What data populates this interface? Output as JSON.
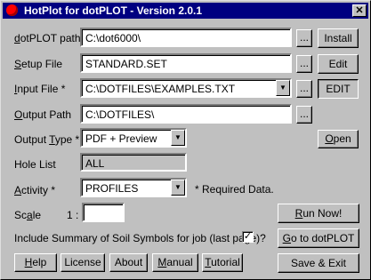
{
  "window": {
    "title": "HotPlot for dotPLOT - Version 2.0.1",
    "close_glyph": "✕"
  },
  "rows": {
    "dotplot_path": {
      "label_ul": "d",
      "label_rest": "otPLOT path*",
      "value": "C:\\dot6000\\",
      "browse": "...",
      "action": "Install"
    },
    "setup_file": {
      "label_ul": "S",
      "label_rest": "etup File",
      "value": "STANDARD.SET",
      "browse": "...",
      "action": "Edit"
    },
    "input_file": {
      "label_ul": "I",
      "label_rest": "nput File *",
      "value": "C:\\DOTFILES\\EXAMPLES.TXT",
      "browse": "...",
      "action": "EDIT"
    },
    "output_path": {
      "label_ul": "O",
      "label_rest": "utput Path",
      "value": "C:\\DOTFILES\\",
      "browse": "..."
    },
    "output_type": {
      "label_pre": "Output ",
      "label_ul": "T",
      "label_rest": "ype *",
      "value": "PDF + Preview",
      "action_ul": "O",
      "action_rest": "pen"
    },
    "hole_list": {
      "label": "Hole List",
      "value": "ALL"
    },
    "activity": {
      "label_ul": "A",
      "label_rest": "ctivity *",
      "value": "PROFILES",
      "note": "* Required Data."
    },
    "scale": {
      "label_pre": "Sc",
      "label_ul": "a",
      "label_rest": "le",
      "ratio": "1 :",
      "value": ""
    }
  },
  "summary_check": {
    "label": "Include Summary of Soil Symbols for job (last page)?",
    "checked": "✓"
  },
  "right_buttons": {
    "run_now_ul": "R",
    "run_now_rest": "un Now!",
    "goto_ul": "G",
    "goto_rest": "o to dotPLOT",
    "save_exit": "Save & Exit"
  },
  "bottom_buttons": {
    "help_ul": "H",
    "help_rest": "elp",
    "license": "License",
    "about": "About",
    "manual_ul": "M",
    "manual_rest": "anual",
    "tutorial_ul": "T",
    "tutorial_rest": "utorial"
  },
  "icons": {
    "dropdown": "down-triangle",
    "app": "red-circle"
  },
  "colors": {
    "titlebar": "#000080",
    "face": "#c0c0c0",
    "app_icon": "#ff0000"
  }
}
